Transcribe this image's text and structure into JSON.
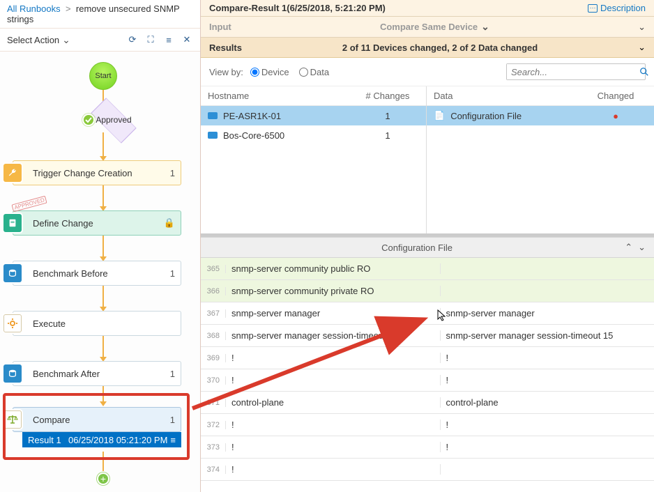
{
  "breadcrumb": {
    "root": "All Runbooks",
    "current": "remove unsecured SNMP strings"
  },
  "sidebar": {
    "select_action": "Select Action",
    "start": "Start",
    "approved": "Approved",
    "plus": "+",
    "approved_badge": "APPROVED",
    "steps": [
      {
        "title": "Trigger Change Creation",
        "count": "1"
      },
      {
        "title": "Define Change",
        "count": ""
      },
      {
        "title": "Benchmark Before",
        "count": "1"
      },
      {
        "title": "Execute",
        "count": ""
      },
      {
        "title": "Benchmark After",
        "count": "1"
      },
      {
        "title": "Compare",
        "count": "1"
      }
    ],
    "result": {
      "label": "Result 1",
      "date": "06/25/2018 05:21:20 PM"
    }
  },
  "header": {
    "title": "Compare-Result 1(6/25/2018, 5:21:20 PM)",
    "description": "Description",
    "input_label": "Input",
    "input_mode": "Compare Same Device",
    "results_label": "Results",
    "results_summary": "2 of 11 Devices changed,  2 of 2 Data changed"
  },
  "viewby": {
    "label": "View by:",
    "opt_device": "Device",
    "opt_data": "Data",
    "search_placeholder": "Search..."
  },
  "devtable": {
    "h_hostname": "Hostname",
    "h_changes": "# Changes",
    "h_data": "Data",
    "h_changed": "Changed",
    "rows": [
      {
        "name": "PE-ASR1K-01",
        "changes": "1"
      },
      {
        "name": "Bos-Core-6500",
        "changes": "1"
      }
    ],
    "data_item": "Configuration File",
    "dot": "●"
  },
  "cfg": {
    "title": "Configuration File",
    "rows": [
      {
        "n": "365",
        "l": "snmp-server community public RO",
        "r": "",
        "removed": true
      },
      {
        "n": "366",
        "l": "snmp-server community private RO",
        "r": "",
        "removed": true
      },
      {
        "n": "367",
        "l": "snmp-server manager",
        "r": "snmp-server manager",
        "removed": false
      },
      {
        "n": "368",
        "l": "snmp-server manager session-timeout 15",
        "r": "snmp-server manager session-timeout 15",
        "removed": false
      },
      {
        "n": "369",
        "l": "!",
        "r": "!",
        "removed": false
      },
      {
        "n": "370",
        "l": "!",
        "r": "!",
        "removed": false
      },
      {
        "n": "371",
        "l": "control-plane",
        "r": "control-plane",
        "removed": false
      },
      {
        "n": "372",
        "l": "!",
        "r": "!",
        "removed": false
      },
      {
        "n": "373",
        "l": "!",
        "r": "!",
        "removed": false
      },
      {
        "n": "374",
        "l": "!",
        "r": "",
        "removed": false
      }
    ]
  }
}
